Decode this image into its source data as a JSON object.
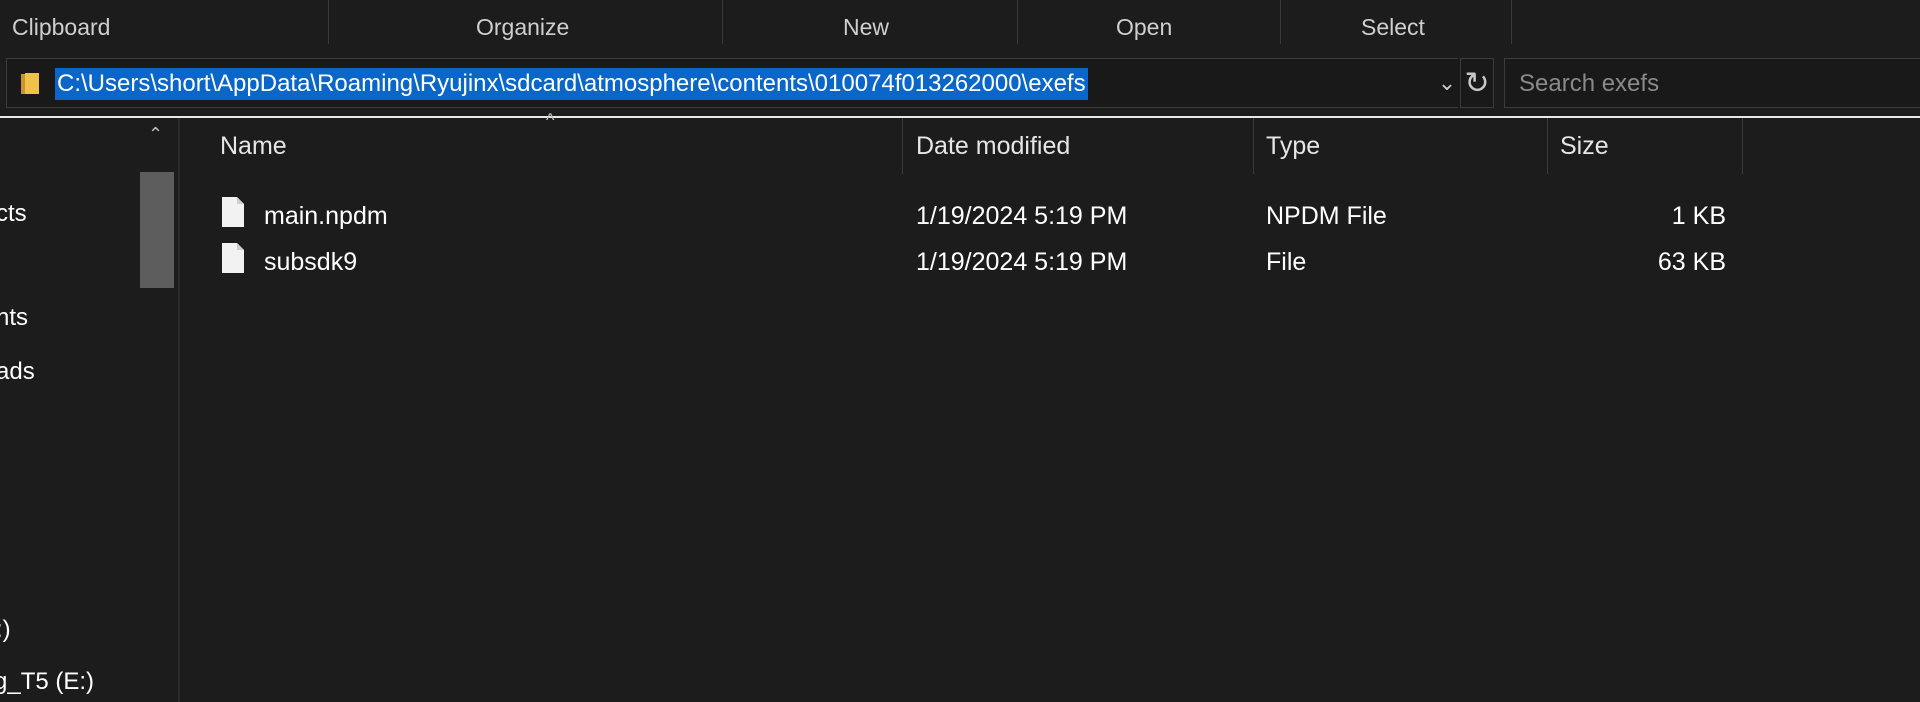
{
  "ribbon": {
    "groups": [
      "Clipboard",
      "Organize",
      "New",
      "Open",
      "Select"
    ]
  },
  "address": {
    "path": "C:\\Users\\short\\AppData\\Roaming\\Ryujinx\\sdcard\\atmosphere\\contents\\010074f013262000\\exefs",
    "dropdown_icon": "chevron-down-icon",
    "refresh_icon": "refresh-icon"
  },
  "search": {
    "placeholder": "Search exefs",
    "value": ""
  },
  "nav": {
    "items": [
      "cts",
      "nts",
      "ads",
      ":)",
      "g_T5 (E:)"
    ]
  },
  "file_list": {
    "columns": [
      "Name",
      "Date modified",
      "Type",
      "Size"
    ],
    "rows": [
      {
        "name": "main.npdm",
        "date": "1/19/2024 5:19 PM",
        "type": "NPDM File",
        "size": "1 KB"
      },
      {
        "name": "subsdk9",
        "date": "1/19/2024 5:19 PM",
        "type": "File",
        "size": "63 KB"
      }
    ]
  },
  "colors": {
    "background": "#1c1c1c",
    "selection": "#0a66c8",
    "folder_yellow": "#f0c24b"
  }
}
